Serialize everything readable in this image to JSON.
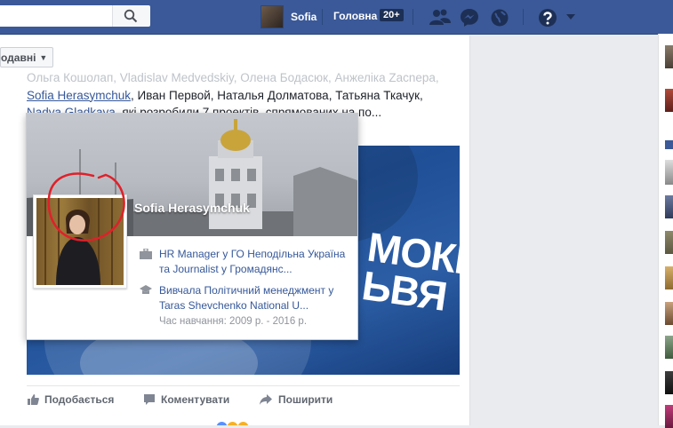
{
  "topbar": {
    "profile_name": "Sofia",
    "home_label": "Головна",
    "home_badge": "20+"
  },
  "feed": {
    "filter_label": "одавні"
  },
  "post": {
    "names_line1": "Ольга Кошолап, Vladislav Medvedskiy, Олена Бодасюк, Анжеліка Zacnepa,",
    "link_sofia": "Sofia Herasymchuk",
    "names_line2_rest": ", Иван Первой, Наталья Долматова, Татьяна Ткачук,",
    "link_nadya": "Nadya Gladkaya",
    "names_line3_rest": ", які розробили 7 проектів, спрямованих на по...",
    "image_text": "МОКР\nЬВЯ",
    "actions": {
      "like": "Подобається",
      "comment": "Коментувати",
      "share": "Поширити"
    }
  },
  "hovercard": {
    "name": "Sofia Herasymchuk",
    "work": "HR Manager у ГО Неподільна Україна та Journalist у Громадянс...",
    "edu_line1": "Вивчала Політичний менеджмент у Taras Shevchenko National U...",
    "edu_years": "Час навчання: 2009 р. - 2016 р."
  },
  "colors": {
    "brand": "#3b5998",
    "link": "#365899",
    "annotation_circle": "#e0202a"
  }
}
